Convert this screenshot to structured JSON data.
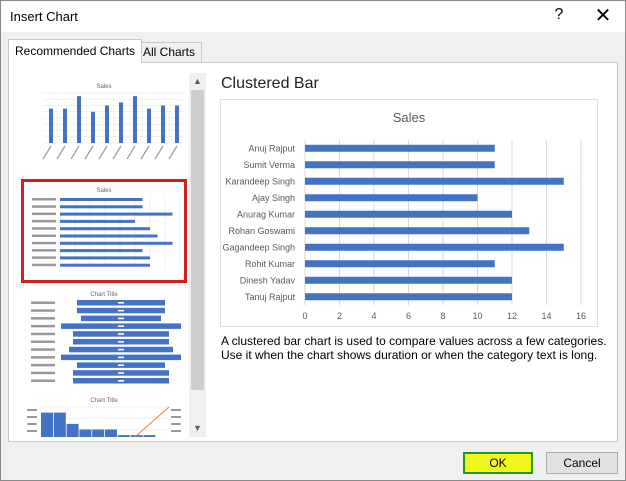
{
  "window": {
    "title": "Insert Chart",
    "help_glyph": "?",
    "close_glyph": "✕"
  },
  "tabs": {
    "recommended": "Recommended Charts",
    "all": "All Charts"
  },
  "selected_chart": {
    "type_name": "Clustered Bar",
    "description": "A clustered bar chart is used to compare values across a few categories. Use it when the chart shows duration or when the category text is long."
  },
  "thumbnails": [
    {
      "title": "Sales"
    },
    {
      "title": "Sales"
    },
    {
      "title": "Chart Title"
    },
    {
      "title": "Chart Title"
    }
  ],
  "chart_data": {
    "type": "bar",
    "orientation": "horizontal",
    "title": "Sales",
    "categories": [
      "Anuj Rajput",
      "Sumit Verma",
      "Karandeep Singh",
      "Ajay Singh",
      "Anurag Kumar",
      "Rohan Goswami",
      "Gagandeep Singh",
      "Rohit Kumar",
      "Dinesh Yadav",
      "Tanuj Rajput"
    ],
    "values": [
      11,
      11,
      15,
      10,
      12,
      13,
      15,
      11,
      12,
      12
    ],
    "xticks": [
      0,
      2,
      4,
      6,
      8,
      10,
      12,
      14,
      16
    ],
    "xlim": [
      0,
      16
    ],
    "grid": true,
    "color": "#4472c4"
  },
  "buttons": {
    "ok": "OK",
    "cancel": "Cancel"
  },
  "colors": {
    "bar": "#4472c4",
    "line": "#ed7d31",
    "selection": "#d0201f"
  }
}
